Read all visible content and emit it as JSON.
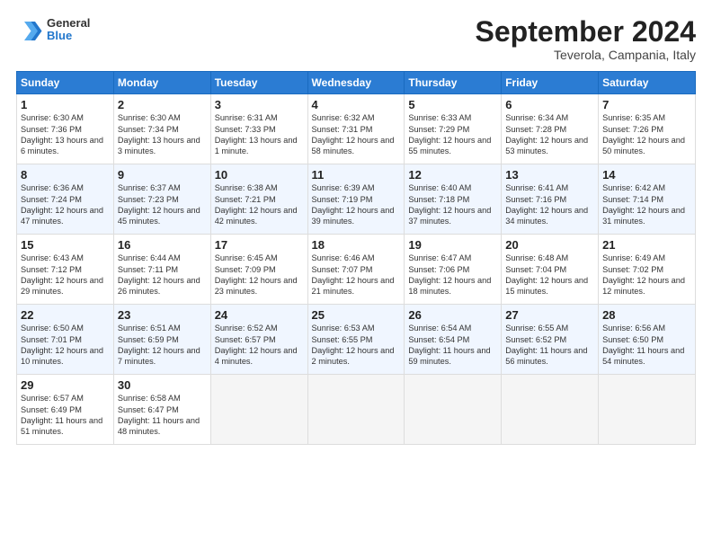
{
  "header": {
    "logo_line1": "General",
    "logo_line2": "Blue",
    "month_title": "September 2024",
    "location": "Teverola, Campania, Italy"
  },
  "days_of_week": [
    "Sunday",
    "Monday",
    "Tuesday",
    "Wednesday",
    "Thursday",
    "Friday",
    "Saturday"
  ],
  "weeks": [
    [
      {
        "day": "1",
        "sunrise": "6:30 AM",
        "sunset": "7:36 PM",
        "daylight": "13 hours and 6 minutes."
      },
      {
        "day": "2",
        "sunrise": "6:30 AM",
        "sunset": "7:34 PM",
        "daylight": "13 hours and 3 minutes."
      },
      {
        "day": "3",
        "sunrise": "6:31 AM",
        "sunset": "7:33 PM",
        "daylight": "13 hours and 1 minute."
      },
      {
        "day": "4",
        "sunrise": "6:32 AM",
        "sunset": "7:31 PM",
        "daylight": "12 hours and 58 minutes."
      },
      {
        "day": "5",
        "sunrise": "6:33 AM",
        "sunset": "7:29 PM",
        "daylight": "12 hours and 55 minutes."
      },
      {
        "day": "6",
        "sunrise": "6:34 AM",
        "sunset": "7:28 PM",
        "daylight": "12 hours and 53 minutes."
      },
      {
        "day": "7",
        "sunrise": "6:35 AM",
        "sunset": "7:26 PM",
        "daylight": "12 hours and 50 minutes."
      }
    ],
    [
      {
        "day": "8",
        "sunrise": "6:36 AM",
        "sunset": "7:24 PM",
        "daylight": "12 hours and 47 minutes."
      },
      {
        "day": "9",
        "sunrise": "6:37 AM",
        "sunset": "7:23 PM",
        "daylight": "12 hours and 45 minutes."
      },
      {
        "day": "10",
        "sunrise": "6:38 AM",
        "sunset": "7:21 PM",
        "daylight": "12 hours and 42 minutes."
      },
      {
        "day": "11",
        "sunrise": "6:39 AM",
        "sunset": "7:19 PM",
        "daylight": "12 hours and 39 minutes."
      },
      {
        "day": "12",
        "sunrise": "6:40 AM",
        "sunset": "7:18 PM",
        "daylight": "12 hours and 37 minutes."
      },
      {
        "day": "13",
        "sunrise": "6:41 AM",
        "sunset": "7:16 PM",
        "daylight": "12 hours and 34 minutes."
      },
      {
        "day": "14",
        "sunrise": "6:42 AM",
        "sunset": "7:14 PM",
        "daylight": "12 hours and 31 minutes."
      }
    ],
    [
      {
        "day": "15",
        "sunrise": "6:43 AM",
        "sunset": "7:12 PM",
        "daylight": "12 hours and 29 minutes."
      },
      {
        "day": "16",
        "sunrise": "6:44 AM",
        "sunset": "7:11 PM",
        "daylight": "12 hours and 26 minutes."
      },
      {
        "day": "17",
        "sunrise": "6:45 AM",
        "sunset": "7:09 PM",
        "daylight": "12 hours and 23 minutes."
      },
      {
        "day": "18",
        "sunrise": "6:46 AM",
        "sunset": "7:07 PM",
        "daylight": "12 hours and 21 minutes."
      },
      {
        "day": "19",
        "sunrise": "6:47 AM",
        "sunset": "7:06 PM",
        "daylight": "12 hours and 18 minutes."
      },
      {
        "day": "20",
        "sunrise": "6:48 AM",
        "sunset": "7:04 PM",
        "daylight": "12 hours and 15 minutes."
      },
      {
        "day": "21",
        "sunrise": "6:49 AM",
        "sunset": "7:02 PM",
        "daylight": "12 hours and 12 minutes."
      }
    ],
    [
      {
        "day": "22",
        "sunrise": "6:50 AM",
        "sunset": "7:01 PM",
        "daylight": "12 hours and 10 minutes."
      },
      {
        "day": "23",
        "sunrise": "6:51 AM",
        "sunset": "6:59 PM",
        "daylight": "12 hours and 7 minutes."
      },
      {
        "day": "24",
        "sunrise": "6:52 AM",
        "sunset": "6:57 PM",
        "daylight": "12 hours and 4 minutes."
      },
      {
        "day": "25",
        "sunrise": "6:53 AM",
        "sunset": "6:55 PM",
        "daylight": "12 hours and 2 minutes."
      },
      {
        "day": "26",
        "sunrise": "6:54 AM",
        "sunset": "6:54 PM",
        "daylight": "11 hours and 59 minutes."
      },
      {
        "day": "27",
        "sunrise": "6:55 AM",
        "sunset": "6:52 PM",
        "daylight": "11 hours and 56 minutes."
      },
      {
        "day": "28",
        "sunrise": "6:56 AM",
        "sunset": "6:50 PM",
        "daylight": "11 hours and 54 minutes."
      }
    ],
    [
      {
        "day": "29",
        "sunrise": "6:57 AM",
        "sunset": "6:49 PM",
        "daylight": "11 hours and 51 minutes."
      },
      {
        "day": "30",
        "sunrise": "6:58 AM",
        "sunset": "6:47 PM",
        "daylight": "11 hours and 48 minutes."
      },
      null,
      null,
      null,
      null,
      null
    ]
  ]
}
